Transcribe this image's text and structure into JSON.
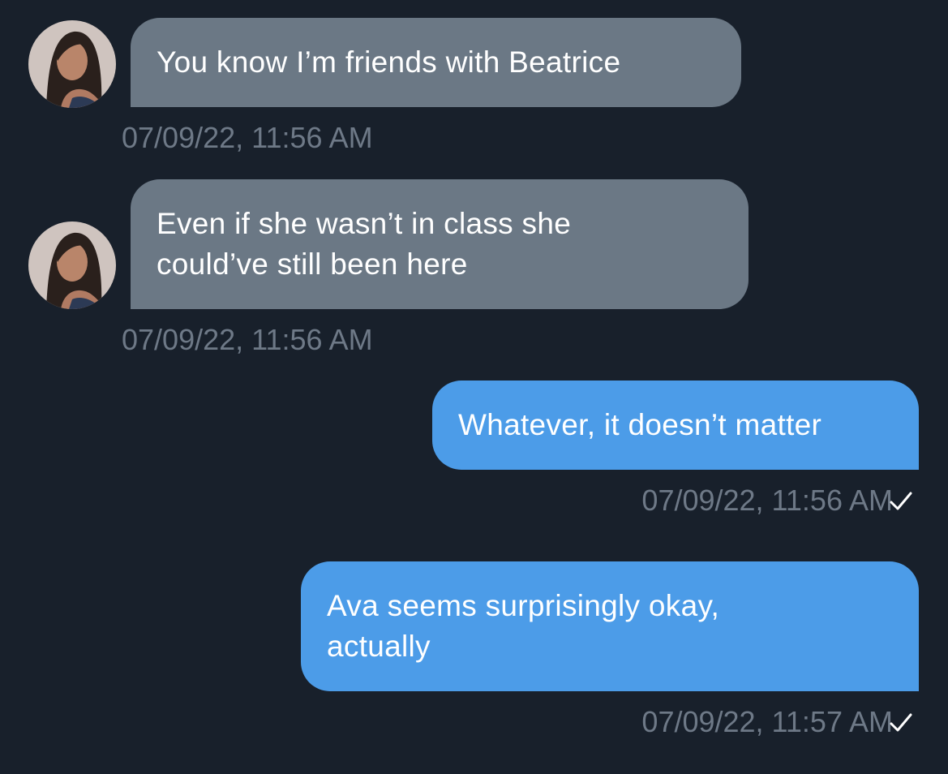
{
  "messages": [
    {
      "direction": "incoming",
      "text": "You know I’m friends with Beatrice",
      "timestamp": "07/09/22, 11:56 AM"
    },
    {
      "direction": "incoming",
      "text": "Even if she wasn’t in class she could’ve still been here",
      "timestamp": "07/09/22, 11:56 AM"
    },
    {
      "direction": "outgoing",
      "text": "Whatever, it doesn’t matter",
      "timestamp": "07/09/22, 11:56 AM",
      "status_icon": "checkmark-icon"
    },
    {
      "direction": "outgoing",
      "text": "Ava seems surprisingly okay, actually",
      "timestamp": "07/09/22, 11:57 AM",
      "status_icon": "checkmark-icon"
    }
  ],
  "colors": {
    "background": "#18202b",
    "incoming_bubble": "#6b7885",
    "outgoing_bubble": "#4c9ce8",
    "timestamp": "#6e7987",
    "text": "#ffffff"
  }
}
